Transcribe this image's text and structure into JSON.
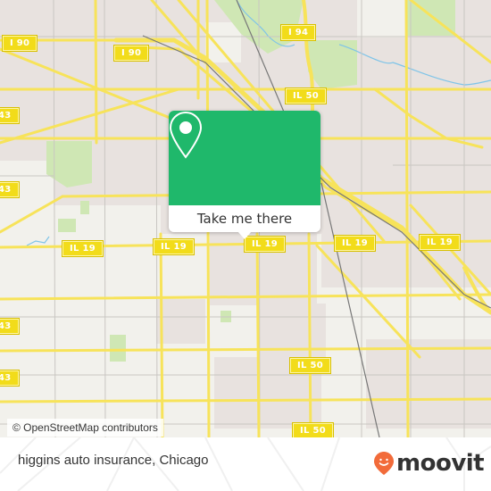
{
  "map": {
    "attribution": "© OpenStreetMap contributors",
    "colors": {
      "land": "#f2f1ec",
      "residential": "#e8e2df",
      "park": "#cfe7b4",
      "water": "#7fc4e8",
      "road": "#f7e35a",
      "minor_road": "#c9c6c2",
      "rail": "#777777",
      "shield": "#f2dc1a"
    },
    "shields": [
      {
        "label": "I 90"
      },
      {
        "label": "I 90"
      },
      {
        "label": "I 94"
      },
      {
        "label": "IL 50"
      },
      {
        "label": "43"
      },
      {
        "label": "43"
      },
      {
        "label": "IL 19"
      },
      {
        "label": "IL 19"
      },
      {
        "label": "IL 19"
      },
      {
        "label": "IL 19"
      },
      {
        "label": "IL 19"
      },
      {
        "label": "43"
      },
      {
        "label": "43"
      },
      {
        "label": "IL 50"
      },
      {
        "label": "IL 50"
      }
    ]
  },
  "popup": {
    "button_label": "Take me there",
    "icon": "map-pin-icon",
    "color": "#1fb86b"
  },
  "footer": {
    "title": "higgins auto insurance, Chicago",
    "brand": "moovit",
    "brand_color": "#f26b3a"
  }
}
